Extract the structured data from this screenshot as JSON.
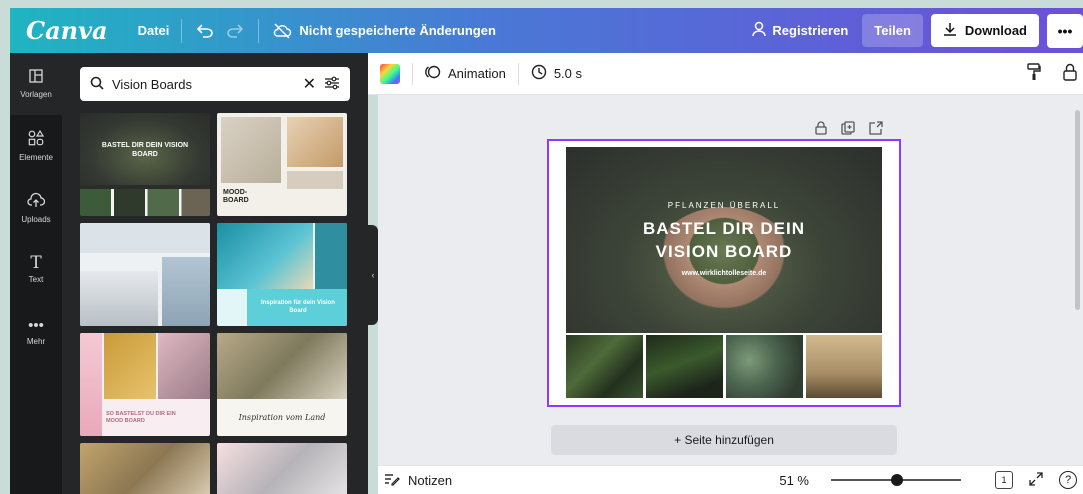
{
  "topbar": {
    "logo": "Canva",
    "file_menu": "Datei",
    "unsaved_status": "Nicht gespeicherte Änderungen",
    "register": "Registrieren",
    "share": "Teilen",
    "download": "Download",
    "more": "•••"
  },
  "rail": {
    "templates": "Vorlagen",
    "elements": "Elemente",
    "uploads": "Uploads",
    "text": "Text",
    "more": "Mehr"
  },
  "search": {
    "value": "Vision Boards"
  },
  "thumbnails": {
    "t1_title": "BASTEL DIR DEIN VISION BOARD",
    "t2_title": "MOOD-BOARD",
    "t4_title": "Inspiration für dein Vision Board",
    "t5_title": "SO BASTELST DU DIR EIN MOOD BOARD",
    "t6_title": "Inspiration vom Land"
  },
  "editor_toolbar": {
    "animation": "Animation",
    "duration": "5.0 s"
  },
  "design": {
    "kicker": "PFLANZEN ÜBERALL",
    "title_line1": "BASTEL DIR DEIN",
    "title_line2": "VISION BOARD",
    "url": "www.wirklichtolleseite.de"
  },
  "add_page": "+ Seite hinzufügen",
  "bottombar": {
    "notes": "Notizen",
    "zoom": "51 %",
    "zoom_level": 0.51,
    "page_count": "1"
  },
  "colors": {
    "accent": "#8b3dff",
    "panel": "#252627",
    "rail": "#18191b"
  }
}
